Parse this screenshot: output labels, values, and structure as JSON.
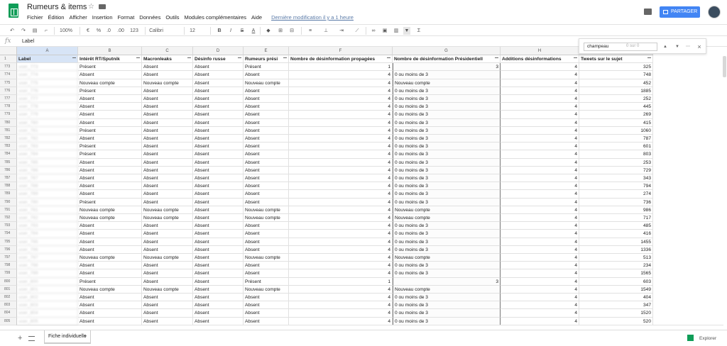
{
  "app": {
    "title": "Rumeurs & items",
    "last_edit": "Dernière modification il y a 1 heure",
    "share_label": "PARTAGER"
  },
  "menu": [
    "Fichier",
    "Édition",
    "Afficher",
    "Insertion",
    "Format",
    "Données",
    "Outils",
    "Modules complémentaires",
    "Aide"
  ],
  "toolbar": {
    "zoom": "100%",
    "currency": "€",
    "percent": "%",
    "decimal_less": ".0",
    "decimal_more": ".00",
    "format_more": "123",
    "font": "Calibri",
    "font_size": "12",
    "bold": "B",
    "italic": "I",
    "strike": "S",
    "text_color": "A",
    "functions": "Σ"
  },
  "formula_bar": {
    "fx": "fx",
    "value": "Label"
  },
  "find": {
    "query": "champeau",
    "count": "0 sur 0"
  },
  "columns": [
    "A",
    "B",
    "C",
    "D",
    "E",
    "F",
    "G",
    "H",
    "I"
  ],
  "header_row": {
    "number": "1",
    "cells": [
      "Label",
      "Intérêt RT/Sputnik",
      "Macronleaks",
      "Désinfo russe",
      "Rumeurs prési",
      "Nombre de désinformation propagées",
      "Nombre de désinformation Présidentiell",
      "Additions désinformations",
      "Tweets sur le sujet"
    ]
  },
  "rows": [
    {
      "n": "773",
      "label": "user_773",
      "b": "Présent",
      "c": "Absent",
      "d": "Absent",
      "e": "Présent",
      "f": "1",
      "g": "3",
      "h": "4",
      "i": "325"
    },
    {
      "n": "774",
      "label": "user_774",
      "b": "Absent",
      "c": "Absent",
      "d": "Absent",
      "e": "Absent",
      "f": "4",
      "g": "0 ou moins de 3",
      "h": "4",
      "i": "748"
    },
    {
      "n": "775",
      "label": "user_775",
      "b": "Nouveau compte",
      "c": "Nouveau compte",
      "d": "Absent",
      "e": "Nouveau compte",
      "f": "4",
      "g": "Nouveau compte",
      "h": "4",
      "i": "452"
    },
    {
      "n": "776",
      "label": "user_776",
      "b": "Présent",
      "c": "Absent",
      "d": "Absent",
      "e": "Absent",
      "f": "4",
      "g": "0 ou moins de 3",
      "h": "4",
      "i": "1885"
    },
    {
      "n": "777",
      "label": "user_777",
      "b": "Absent",
      "c": "Absent",
      "d": "Absent",
      "e": "Absent",
      "f": "4",
      "g": "0 ou moins de 3",
      "h": "4",
      "i": "252"
    },
    {
      "n": "778",
      "label": "user_778",
      "b": "Absent",
      "c": "Absent",
      "d": "Absent",
      "e": "Absent",
      "f": "4",
      "g": "0 ou moins de 3",
      "h": "4",
      "i": "445"
    },
    {
      "n": "779",
      "label": "user_779",
      "b": "Absent",
      "c": "Absent",
      "d": "Absent",
      "e": "Absent",
      "f": "4",
      "g": "0 ou moins de 3",
      "h": "4",
      "i": "269"
    },
    {
      "n": "780",
      "label": "user_780",
      "b": "Absent",
      "c": "Absent",
      "d": "Absent",
      "e": "Absent",
      "f": "4",
      "g": "0 ou moins de 3",
      "h": "4",
      "i": "415"
    },
    {
      "n": "781",
      "label": "user_781",
      "b": "Présent",
      "c": "Absent",
      "d": "Absent",
      "e": "Absent",
      "f": "4",
      "g": "0 ou moins de 3",
      "h": "4",
      "i": "1060"
    },
    {
      "n": "782",
      "label": "user_782",
      "b": "Absent",
      "c": "Absent",
      "d": "Absent",
      "e": "Absent",
      "f": "4",
      "g": "0 ou moins de 3",
      "h": "4",
      "i": "787"
    },
    {
      "n": "783",
      "label": "user_783",
      "b": "Présent",
      "c": "Absent",
      "d": "Absent",
      "e": "Absent",
      "f": "4",
      "g": "0 ou moins de 3",
      "h": "4",
      "i": "601"
    },
    {
      "n": "784",
      "label": "user_784",
      "b": "Présent",
      "c": "Absent",
      "d": "Absent",
      "e": "Absent",
      "f": "4",
      "g": "0 ou moins de 3",
      "h": "4",
      "i": "803"
    },
    {
      "n": "785",
      "label": "user_785",
      "b": "Absent",
      "c": "Absent",
      "d": "Absent",
      "e": "Absent",
      "f": "4",
      "g": "0 ou moins de 3",
      "h": "4",
      "i": "253"
    },
    {
      "n": "786",
      "label": "user_786",
      "b": "Absent",
      "c": "Absent",
      "d": "Absent",
      "e": "Absent",
      "f": "4",
      "g": "0 ou moins de 3",
      "h": "4",
      "i": "729"
    },
    {
      "n": "787",
      "label": "user_787",
      "b": "Absent",
      "c": "Absent",
      "d": "Absent",
      "e": "Absent",
      "f": "4",
      "g": "0 ou moins de 3",
      "h": "4",
      "i": "343"
    },
    {
      "n": "788",
      "label": "user_788",
      "b": "Absent",
      "c": "Absent",
      "d": "Absent",
      "e": "Absent",
      "f": "4",
      "g": "0 ou moins de 3",
      "h": "4",
      "i": "794"
    },
    {
      "n": "789",
      "label": "user_789",
      "b": "Absent",
      "c": "Absent",
      "d": "Absent",
      "e": "Absent",
      "f": "4",
      "g": "0 ou moins de 3",
      "h": "4",
      "i": "274"
    },
    {
      "n": "790",
      "label": "user_790",
      "b": "Présent",
      "c": "Absent",
      "d": "Absent",
      "e": "Absent",
      "f": "4",
      "g": "0 ou moins de 3",
      "h": "4",
      "i": "736"
    },
    {
      "n": "791",
      "label": "user_791",
      "b": "Nouveau compte",
      "c": "Nouveau compte",
      "d": "Absent",
      "e": "Nouveau compte",
      "f": "4",
      "g": "Nouveau compte",
      "h": "4",
      "i": "986"
    },
    {
      "n": "792",
      "label": "user_792",
      "b": "Nouveau compte",
      "c": "Nouveau compte",
      "d": "Absent",
      "e": "Nouveau compte",
      "f": "4",
      "g": "Nouveau compte",
      "h": "4",
      "i": "717"
    },
    {
      "n": "793",
      "label": "user_793",
      "b": "Absent",
      "c": "Absent",
      "d": "Absent",
      "e": "Absent",
      "f": "4",
      "g": "0 ou moins de 3",
      "h": "4",
      "i": "485"
    },
    {
      "n": "794",
      "label": "user_794",
      "b": "Absent",
      "c": "Absent",
      "d": "Absent",
      "e": "Absent",
      "f": "4",
      "g": "0 ou moins de 3",
      "h": "4",
      "i": "416"
    },
    {
      "n": "795",
      "label": "user_795",
      "b": "Absent",
      "c": "Absent",
      "d": "Absent",
      "e": "Absent",
      "f": "4",
      "g": "0 ou moins de 3",
      "h": "4",
      "i": "1455"
    },
    {
      "n": "796",
      "label": "user_796",
      "b": "Absent",
      "c": "Absent",
      "d": "Absent",
      "e": "Absent",
      "f": "4",
      "g": "0 ou moins de 3",
      "h": "4",
      "i": "1336"
    },
    {
      "n": "797",
      "label": "user_797",
      "b": "Nouveau compte",
      "c": "Nouveau compte",
      "d": "Absent",
      "e": "Nouveau compte",
      "f": "4",
      "g": "Nouveau compte",
      "h": "4",
      "i": "513"
    },
    {
      "n": "798",
      "label": "user_798",
      "b": "Absent",
      "c": "Absent",
      "d": "Absent",
      "e": "Absent",
      "f": "4",
      "g": "0 ou moins de 3",
      "h": "4",
      "i": "234"
    },
    {
      "n": "799",
      "label": "user_799",
      "b": "Absent",
      "c": "Absent",
      "d": "Absent",
      "e": "Absent",
      "f": "4",
      "g": "0 ou moins de 3",
      "h": "4",
      "i": "1565"
    },
    {
      "n": "800",
      "label": "user_800",
      "b": "Présent",
      "c": "Absent",
      "d": "Absent",
      "e": "Présent",
      "f": "1",
      "g": "3",
      "h": "4",
      "i": "603"
    },
    {
      "n": "801",
      "label": "user_801",
      "b": "Nouveau compte",
      "c": "Nouveau compte",
      "d": "Absent",
      "e": "Nouveau compte",
      "f": "4",
      "g": "Nouveau compte",
      "h": "4",
      "i": "1549"
    },
    {
      "n": "802",
      "label": "user_802",
      "b": "Absent",
      "c": "Absent",
      "d": "Absent",
      "e": "Absent",
      "f": "4",
      "g": "0 ou moins de 3",
      "h": "4",
      "i": "404"
    },
    {
      "n": "803",
      "label": "user_803",
      "b": "Absent",
      "c": "Absent",
      "d": "Absent",
      "e": "Absent",
      "f": "4",
      "g": "0 ou moins de 3",
      "h": "4",
      "i": "347"
    },
    {
      "n": "804",
      "label": "user_804",
      "b": "Absent",
      "c": "Absent",
      "d": "Absent",
      "e": "Absent",
      "f": "4",
      "g": "0 ou moins de 3",
      "h": "4",
      "i": "1520"
    },
    {
      "n": "805",
      "label": "user_805",
      "b": "Absent",
      "c": "Absent",
      "d": "Absent",
      "e": "Absent",
      "f": "4",
      "g": "0 ou moins de 3",
      "h": "4",
      "i": "520"
    }
  ],
  "bottom": {
    "sheet_tab": "Fiche individuelle",
    "explore": "Explorer"
  },
  "colors": {
    "sheets_green": "#0f9d58",
    "share_blue": "#4285f4",
    "selected_header": "#d7e4f6"
  },
  "icons": [
    "undo-icon",
    "redo-icon",
    "print-icon",
    "paint-format-icon",
    "bold-icon",
    "italic-icon",
    "strikethrough-icon",
    "text-color-icon",
    "fill-color-icon",
    "borders-icon",
    "merge-icon",
    "align-icon",
    "valign-icon",
    "wrap-icon",
    "rotate-icon",
    "link-icon",
    "comment-icon",
    "chart-icon",
    "filter-icon",
    "functions-icon",
    "search-icon",
    "close-icon"
  ]
}
